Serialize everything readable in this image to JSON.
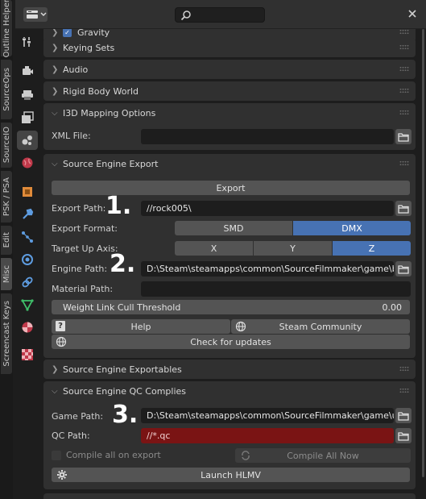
{
  "side_tabs": [
    "Outline Helper",
    "SourceOps",
    "SourceIO",
    "PSK / PSA",
    "Edit",
    "Misc",
    "Screencast Keys"
  ],
  "icons": [
    "tool-icon",
    "render-icon",
    "output-icon",
    "view-layer-icon",
    "scene-icon",
    "world-icon",
    "object-icon",
    "modifier-icon",
    "particles-icon",
    "physics-icon",
    "constraints-icon",
    "data-icon",
    "material-icon",
    "texture-icon"
  ],
  "header": {
    "search_value": ""
  },
  "panels": {
    "gravity": "Gravity",
    "keying_sets": "Keying Sets",
    "audio": "Audio",
    "rigid_body_world": "Rigid Body World",
    "i3d_mapping": "I3D Mapping Options",
    "source_engine_export": "Source Engine Export",
    "source_engine_exportables": "Source Engine Exportables",
    "source_engine_qc": "Source Engine QC Complies"
  },
  "i3d": {
    "xml_file_label": "XML File:",
    "xml_file_value": ""
  },
  "export": {
    "export_button": "Export",
    "export_path_label": "Export Path:",
    "export_path_value": "//rock005\\",
    "export_format_label": "Export Format:",
    "formats": [
      "SMD",
      "DMX"
    ],
    "selected_format": "DMX",
    "target_up_label": "Target Up Axis:",
    "axes": [
      "X",
      "Y",
      "Z"
    ],
    "selected_axis": "Z",
    "engine_path_label": "Engine Path:",
    "engine_path_value": "D:\\Steam\\steamapps\\common\\SourceFilmmaker\\game\\bin\\",
    "material_path_label": "Material Path:",
    "material_path_value": "",
    "weight_link_label": "Weight Link Cull Threshold",
    "weight_link_value": "0.00",
    "help_label": "Help",
    "steam_community_label": "Steam Community",
    "check_updates_label": "Check for updates"
  },
  "qc": {
    "game_path_label": "Game Path:",
    "game_path_value": "D:\\Steam\\steamapps\\common\\SourceFilmmaker\\game\\user...",
    "qc_path_label": "QC Path:",
    "qc_path_value": "//*.qc",
    "compile_all_label": "Compile all on export",
    "compile_all_now_label": "Compile All Now",
    "launch_hlmv_label": "Launch HLMV"
  },
  "annotations": [
    "1.",
    "2.",
    "3."
  ],
  "colors": {
    "accent": "#4772b3",
    "error_field": "#7a1414",
    "panel": "#303030",
    "background": "#1d1d1d"
  }
}
